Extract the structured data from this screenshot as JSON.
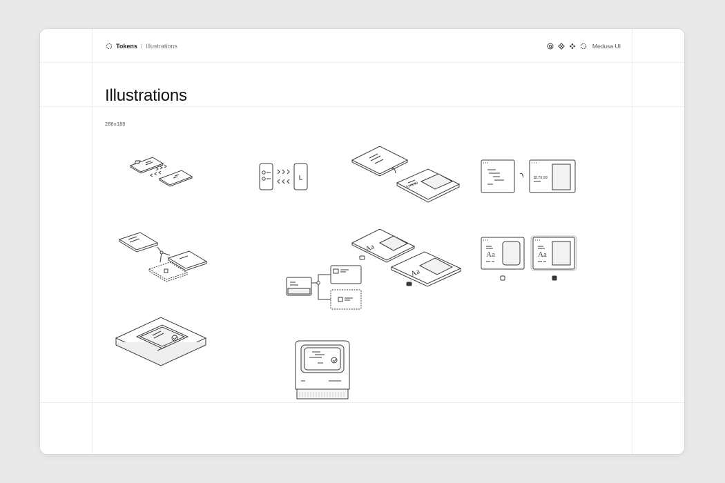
{
  "breadcrumb": {
    "root_label": "Tokens",
    "separator": "/",
    "current_label": "Illustrations"
  },
  "header_tools": {
    "icons": [
      "at-icon",
      "diamond-grid-icon",
      "diamonds-icon",
      "medusa-logo-icon"
    ],
    "brand_label": "Medusa UI"
  },
  "page": {
    "title": "Illustrations",
    "size_label": "280x180"
  },
  "illustrations": [
    {
      "name": "isometric-phones-exchange",
      "price": ""
    },
    {
      "name": "flat-phones-exchange",
      "price": ""
    },
    {
      "name": "isometric-tablets-checkout",
      "price": "$179.99"
    },
    {
      "name": "flat-browser-checkout",
      "price": "$179.99"
    },
    {
      "name": "isometric-cards-connection",
      "price": ""
    },
    {
      "name": "flat-cards-connection",
      "price": ""
    },
    {
      "name": "isometric-typography-selection",
      "typeface_label": "Aa"
    },
    {
      "name": "flat-typography-selection",
      "typeface_label": "Aa"
    },
    {
      "name": "isometric-device-card",
      "price": ""
    },
    {
      "name": "retro-computer-card",
      "price": ""
    }
  ],
  "colors": {
    "page_bg": "#e9e9eb",
    "window_bg": "#ffffff",
    "grid_line": "#ececee",
    "stroke": "#3a3a3a",
    "fill_light": "#f2f2f2"
  }
}
